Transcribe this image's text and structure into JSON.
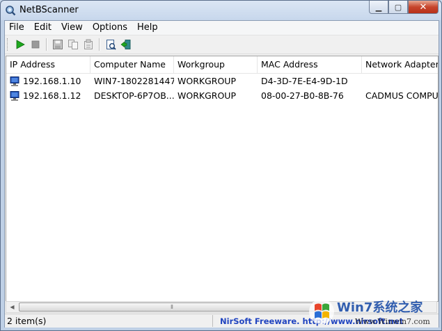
{
  "window": {
    "title": "NetBScanner"
  },
  "menu": [
    "File",
    "Edit",
    "View",
    "Options",
    "Help"
  ],
  "toolbar": {
    "buttons": [
      {
        "icon": "play-icon"
      },
      {
        "icon": "stop-icon"
      },
      {
        "icon": "save-icon"
      },
      {
        "icon": "copy-icon"
      },
      {
        "icon": "properties-icon"
      },
      {
        "icon": "html-report-icon"
      },
      {
        "icon": "exit-icon"
      }
    ]
  },
  "columns": [
    "IP Address",
    "Computer Name",
    "Workgroup",
    "MAC Address",
    "Network Adapter"
  ],
  "rows": [
    {
      "ip": "192.168.1.10",
      "name": "WIN7-1802281447",
      "workgroup": "WORKGROUP",
      "mac": "D4-3D-7E-E4-9D-1D",
      "adapter": ""
    },
    {
      "ip": "192.168.1.12",
      "name": "DESKTOP-6P7OB...",
      "workgroup": "WORKGROUP",
      "mac": "08-00-27-B0-8B-76",
      "adapter": "CADMUS COMPUT"
    }
  ],
  "statusbar": {
    "count": "2 item(s)",
    "link": "NirSoft Freeware.  http://www.nirsoft.net"
  },
  "watermark": {
    "brand": "Win7系统之家",
    "url": "Www.Winwin7.com"
  },
  "colors": {
    "accent": "#2044c0",
    "close": "#c7452c"
  }
}
